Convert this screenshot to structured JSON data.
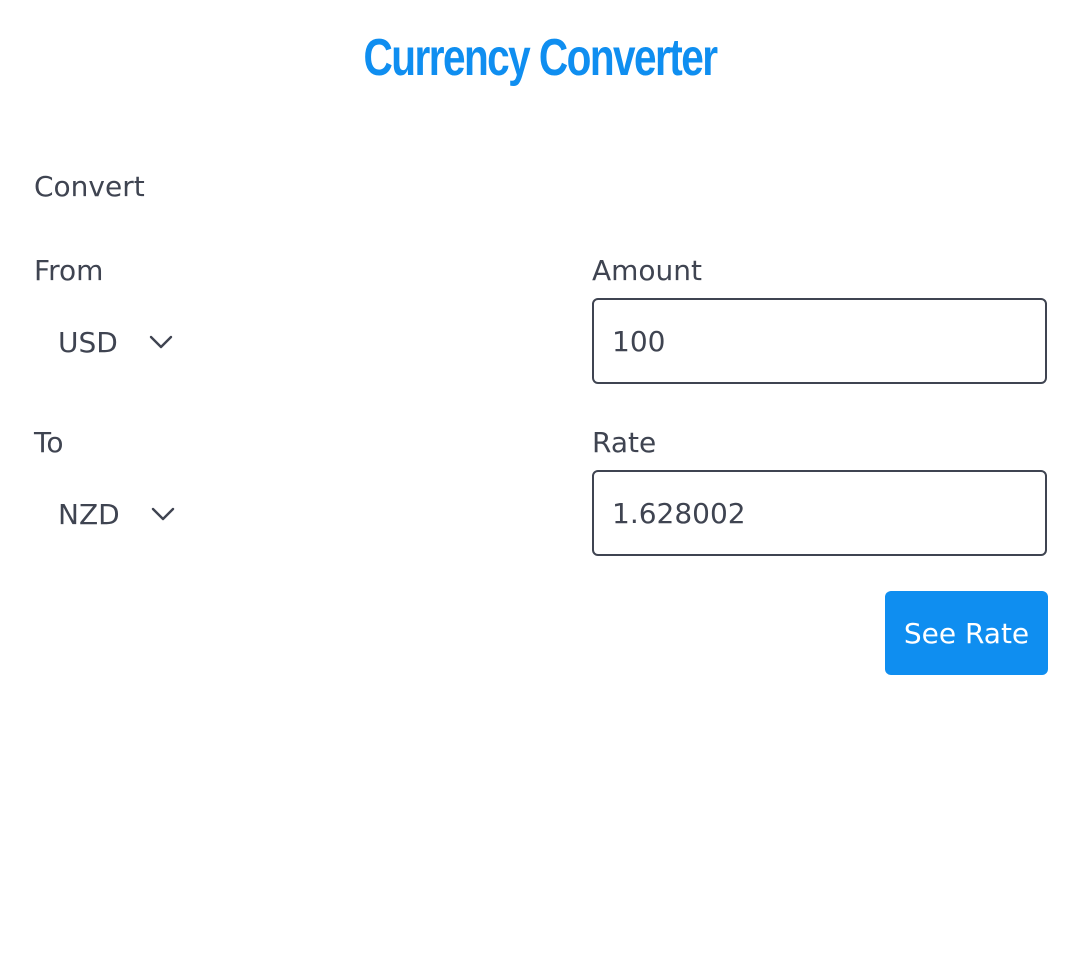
{
  "header": {
    "title": "Currency Converter"
  },
  "form": {
    "section_label": "Convert",
    "from": {
      "label": "From",
      "selected": "USD"
    },
    "to": {
      "label": "To",
      "selected": "NZD"
    },
    "amount": {
      "label": "Amount",
      "value": "100"
    },
    "rate": {
      "label": "Rate",
      "value": "1.628002"
    },
    "see_rate_label": "See Rate"
  },
  "colors": {
    "accent": "#0f8ef0",
    "text": "#3f4451",
    "border": "#3f4451",
    "background": "#ffffff"
  },
  "icons": {
    "dropdown": "chevron-down-icon"
  }
}
